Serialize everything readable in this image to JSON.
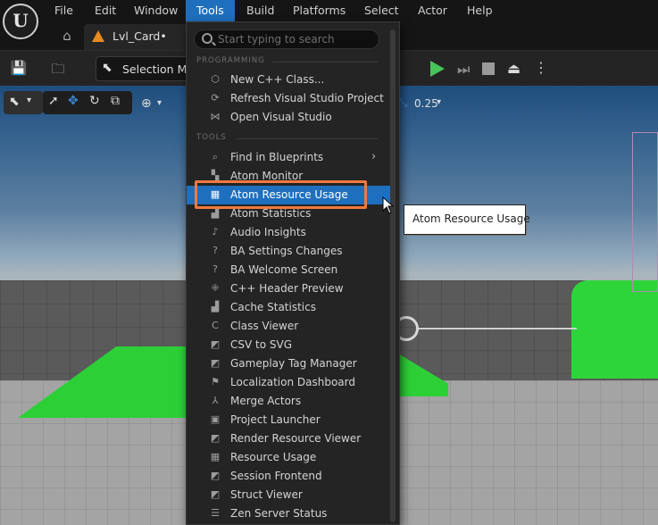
{
  "menubar": {
    "logo": "U",
    "items": [
      "File",
      "Edit",
      "Window",
      "Tools",
      "Build",
      "Platforms",
      "Select",
      "Actor",
      "Help"
    ],
    "active": "Tools"
  },
  "tabs": {
    "home_icon": "home-icon",
    "level_tab": "Lvl_Card•"
  },
  "toolbar": {
    "save_icon": "save-icon",
    "browse_icon": "folder-search-icon",
    "select_mode_label": "Selection Mode",
    "play_color": "#47c35a"
  },
  "viewport": {
    "snap_value": "0.25"
  },
  "tools_menu": {
    "search_placeholder": "Start typing to search",
    "sections": [
      {
        "header": "PROGRAMMING",
        "items": [
          {
            "label": "New C++ Class...",
            "icon": "cpp-class-icon"
          },
          {
            "label": "Refresh Visual Studio Project",
            "icon": "refresh-icon"
          },
          {
            "label": "Open Visual Studio",
            "icon": "visual-studio-icon"
          }
        ]
      },
      {
        "header": "TOOLS",
        "items": [
          {
            "label": "Find in Blueprints",
            "icon": "search-icon",
            "submenu": true
          },
          {
            "label": "Atom Monitor",
            "icon": "monitor-icon"
          },
          {
            "label": "Atom Resource Usage",
            "icon": "table-icon",
            "hovered": true
          },
          {
            "label": "Atom Statistics",
            "icon": "bar-chart-icon"
          },
          {
            "label": "Audio Insights",
            "icon": "audio-icon"
          },
          {
            "label": "BA Settings Changes",
            "icon": "help-icon"
          },
          {
            "label": "BA Welcome Screen",
            "icon": "help-icon"
          },
          {
            "label": "C++ Header Preview",
            "icon": "header-preview-icon"
          },
          {
            "label": "Cache Statistics",
            "icon": "bar-chart-icon"
          },
          {
            "label": "Class Viewer",
            "icon": "class-icon"
          },
          {
            "label": "CSV to SVG",
            "icon": "convert-icon"
          },
          {
            "label": "Gameplay Tag Manager",
            "icon": "tag-icon"
          },
          {
            "label": "Localization Dashboard",
            "icon": "flag-icon"
          },
          {
            "label": "Merge Actors",
            "icon": "merge-icon"
          },
          {
            "label": "Project Launcher",
            "icon": "launcher-icon"
          },
          {
            "label": "Render Resource Viewer",
            "icon": "viewer-icon"
          },
          {
            "label": "Resource Usage",
            "icon": "table-icon"
          },
          {
            "label": "Session Frontend",
            "icon": "session-icon"
          },
          {
            "label": "Struct Viewer",
            "icon": "struct-icon"
          },
          {
            "label": "Zen Server Status",
            "icon": "server-icon"
          }
        ]
      }
    ],
    "hover_color": "#1f6fbf",
    "highlight_color": "#f07a3e"
  },
  "tooltip": {
    "text": "Atom Resource Usage"
  }
}
